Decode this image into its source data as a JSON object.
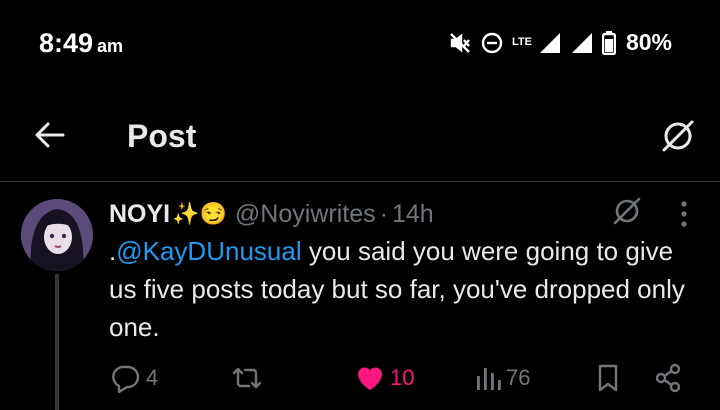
{
  "status_bar": {
    "time": "8:49",
    "ampm": "am",
    "network_label": "LTE",
    "battery": "80%"
  },
  "header": {
    "title": "Post"
  },
  "tweet": {
    "display_name": "NOYI",
    "name_emojis": "✨😏",
    "handle": "@Noyiwrites",
    "separator": "·",
    "age": "14h",
    "text_prefix": ".",
    "mention": "@KayDUnusual",
    "text_rest": " you said you were going to give us five posts today but so far, you've dropped only one."
  },
  "actions": {
    "replies": "4",
    "reposts": "",
    "likes": "10",
    "views": "76"
  },
  "colors": {
    "background": "#000000",
    "text": "#e7e9ea",
    "muted": "#71767b",
    "mention": "#1d9bf0",
    "like": "#f91880",
    "divider": "#2f3336"
  },
  "icons": [
    "back-arrow-icon",
    "grok-icon",
    "more-icon",
    "reply-icon",
    "repost-icon",
    "heart-icon",
    "views-icon",
    "bookmark-icon",
    "share-icon",
    "mute-icon",
    "dnd-icon",
    "signal-icon",
    "battery-icon"
  ]
}
